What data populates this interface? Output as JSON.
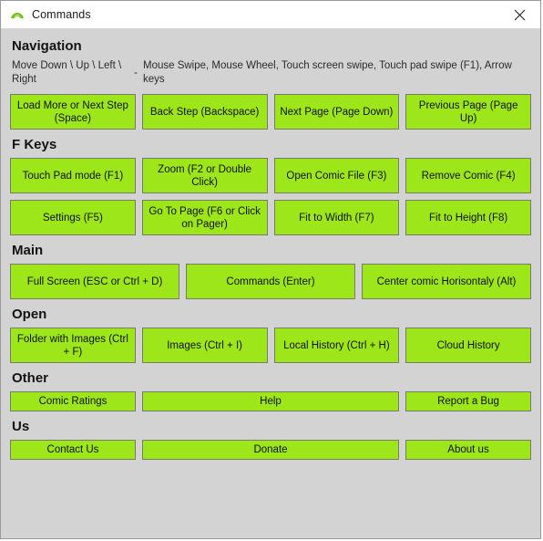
{
  "window": {
    "title": "Commands",
    "app_icon": "mountain-arch-icon",
    "close_label": "✕",
    "accent_green": "#9ce61a",
    "background": "#d3d3d3",
    "titlebar_background": "#ffffff"
  },
  "sections": [
    {
      "id": "navigation",
      "title": "Navigation",
      "description": {
        "keys": "Move Down \\ Up \\ Left \\ Right",
        "dash": "-",
        "values": "Mouse Swipe, Mouse Wheel, Touch screen swipe, Touch pad swipe (F1), Arrow keys"
      },
      "rows": [
        {
          "layout": "four",
          "buttons": [
            "Load More or Next Step (Space)",
            "Back Step (Backspace)",
            "Next Page (Page Down)",
            "Previous Page (Page Up)"
          ]
        }
      ]
    },
    {
      "id": "f-keys",
      "title": "F Keys",
      "rows": [
        {
          "layout": "four",
          "buttons": [
            "Touch Pad mode (F1)",
            "Zoom (F2 or Double Click)",
            "Open Comic File (F3)",
            "Remove Comic (F4)"
          ]
        },
        {
          "layout": "four",
          "buttons": [
            "Settings (F5)",
            "Go To Page (F6 or Click on Pager)",
            "Fit to Width (F7)",
            "Fit to Height (F8)"
          ]
        }
      ]
    },
    {
      "id": "main",
      "title": "Main",
      "rows": [
        {
          "layout": "three",
          "buttons": [
            "Full Screen (ESC or Ctrl + D)",
            "Commands (Enter)",
            "Center comic Horisontaly (Alt)"
          ]
        }
      ]
    },
    {
      "id": "open",
      "title": "Open",
      "rows": [
        {
          "layout": "four",
          "buttons": [
            "Folder with Images (Ctrl + F)",
            "Images (Ctrl + I)",
            "Local History (Ctrl + H)",
            "Cloud History"
          ]
        }
      ]
    },
    {
      "id": "other",
      "title": "Other",
      "rows": [
        {
          "layout": "slim",
          "buttons": [
            "Comic Ratings",
            "Help",
            "Report a Bug"
          ]
        }
      ]
    },
    {
      "id": "us",
      "title": "Us",
      "rows": [
        {
          "layout": "slim",
          "buttons": [
            "Contact Us",
            "Donate",
            "About us"
          ]
        }
      ]
    }
  ]
}
